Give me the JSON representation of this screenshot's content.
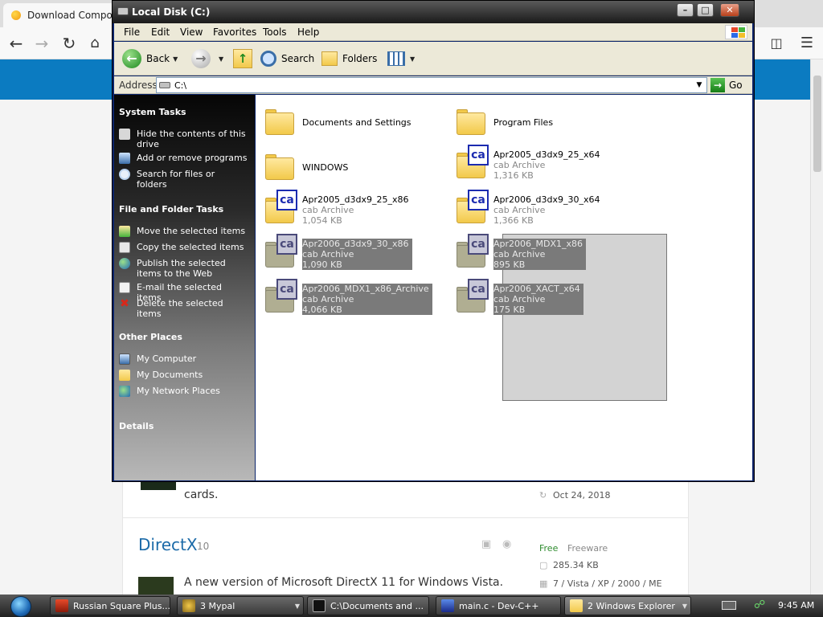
{
  "browser": {
    "tab_title": "Download Compone",
    "content": {
      "cards_text": "cards.",
      "card1_date": "Oct 24, 2018",
      "directx_title": "DirectX",
      "directx_count": "10",
      "directx_license": "Free",
      "directx_type": "Freeware",
      "directx_size": "285.34 KB",
      "directx_os": "7 / Vista / XP / 2000 / ME",
      "directx_desc": "A new version of Microsoft DirectX 11 for Windows Vista."
    }
  },
  "explorer": {
    "title": "Local Disk (C:)",
    "menu": [
      "File",
      "Edit",
      "View",
      "Favorites",
      "Tools",
      "Help"
    ],
    "toolbar": {
      "back": "Back",
      "search": "Search",
      "folders": "Folders"
    },
    "address": {
      "label": "Address",
      "value": "C:\\",
      "go": "Go"
    },
    "task_pane": {
      "system_tasks": {
        "heading": "System Tasks",
        "items": [
          "Hide the contents of this drive",
          "Add or remove programs",
          "Search for files or folders"
        ]
      },
      "file_folder_tasks": {
        "heading": "File and Folder Tasks",
        "items": [
          "Move the selected items",
          "Copy the selected items",
          "Publish the selected items to the Web",
          "E-mail the selected items",
          "Delete the selected items"
        ]
      },
      "other_places": {
        "heading": "Other Places",
        "items": [
          "My Computer",
          "My Documents",
          "My Network Places"
        ]
      },
      "details": {
        "heading": "Details"
      }
    },
    "files": [
      {
        "name": "Documents and Settings",
        "kind": "folder",
        "selected": false
      },
      {
        "name": "Program Files",
        "kind": "folder",
        "selected": false
      },
      {
        "name": "WINDOWS",
        "kind": "folder",
        "selected": false
      },
      {
        "name": "Apr2005_d3dx9_25_x64",
        "type": "cab Archive",
        "size": "1,316 KB",
        "kind": "cab",
        "selected": false
      },
      {
        "name": "Apr2005_d3dx9_25_x86",
        "type": "cab Archive",
        "size": "1,054 KB",
        "kind": "cab",
        "selected": false
      },
      {
        "name": "Apr2006_d3dx9_30_x64",
        "type": "cab Archive",
        "size": "1,366 KB",
        "kind": "cab",
        "selected": false
      },
      {
        "name": "Apr2006_d3dx9_30_x86",
        "type": "cab Archive",
        "size": "1,090 KB",
        "kind": "cab",
        "selected": true
      },
      {
        "name": "Apr2006_MDX1_x86",
        "type": "cab Archive",
        "size": "895 KB",
        "kind": "cab",
        "selected": true
      },
      {
        "name": "Apr2006_MDX1_x86_Archive",
        "type": "cab Archive",
        "size": "4,066 KB",
        "kind": "cab",
        "selected": true
      },
      {
        "name": "Apr2006_XACT_x64",
        "type": "cab Archive",
        "size": "175 KB",
        "kind": "cab",
        "selected": true
      }
    ]
  },
  "taskbar": {
    "buttons": [
      {
        "label": "Russian Square Plus...",
        "active": false
      },
      {
        "label": "3 Mypal",
        "active": false
      },
      {
        "label": "C:\\Documents and ...",
        "active": false
      },
      {
        "label": "main.c - Dev-C++",
        "active": false
      },
      {
        "label": "2 Windows Explorer",
        "active": true
      }
    ],
    "clock": "9:45 AM"
  },
  "colors": {
    "selection_grey": "#7a7a7a",
    "cab_blue": "#1b2bb0",
    "folder_yellow": "#f2c94a",
    "go_green": "#1f8a1f"
  }
}
